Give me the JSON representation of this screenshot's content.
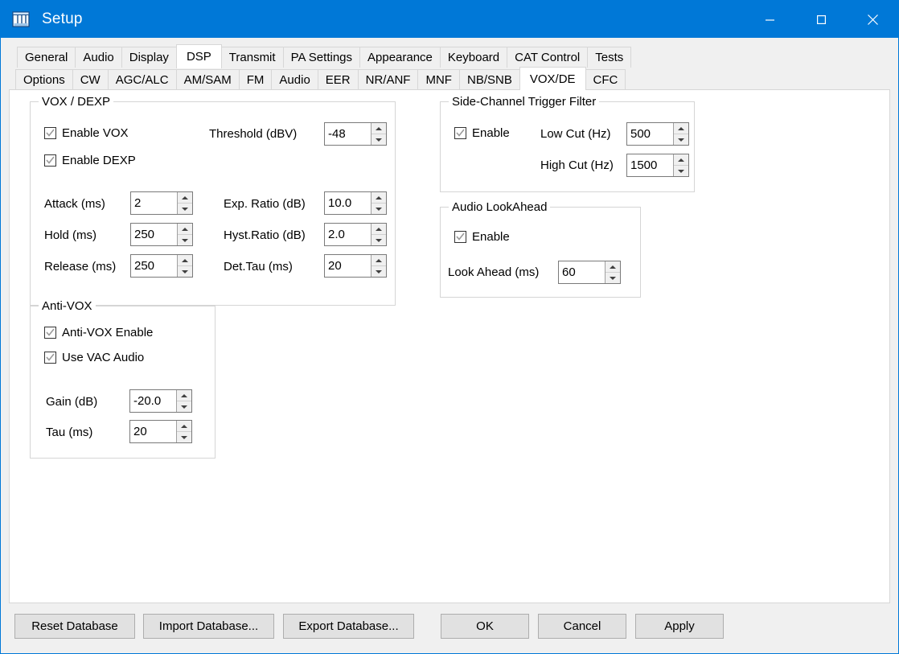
{
  "window": {
    "title": "Setup",
    "icon": "setup-window-icon",
    "titlebar_color": "#0078d7",
    "minimize_label": "Minimize",
    "maximize_label": "Maximize",
    "close_label": "Close"
  },
  "tabs_primary": [
    {
      "label": "General",
      "selected": false
    },
    {
      "label": "Audio",
      "selected": false
    },
    {
      "label": "Display",
      "selected": false
    },
    {
      "label": "DSP",
      "selected": true
    },
    {
      "label": "Transmit",
      "selected": false
    },
    {
      "label": "PA Settings",
      "selected": false
    },
    {
      "label": "Appearance",
      "selected": false
    },
    {
      "label": "Keyboard",
      "selected": false
    },
    {
      "label": "CAT Control",
      "selected": false
    },
    {
      "label": "Tests",
      "selected": false
    }
  ],
  "tabs_secondary": [
    {
      "label": "Options",
      "selected": false
    },
    {
      "label": "CW",
      "selected": false
    },
    {
      "label": "AGC/ALC",
      "selected": false
    },
    {
      "label": "AM/SAM",
      "selected": false
    },
    {
      "label": "FM",
      "selected": false
    },
    {
      "label": "Audio",
      "selected": false
    },
    {
      "label": "EER",
      "selected": false
    },
    {
      "label": "NR/ANF",
      "selected": false
    },
    {
      "label": "MNF",
      "selected": false
    },
    {
      "label": "NB/SNB",
      "selected": false
    },
    {
      "label": "VOX/DE",
      "selected": true
    },
    {
      "label": "CFC",
      "selected": false
    }
  ],
  "vox_dexp": {
    "title": "VOX / DEXP",
    "enable_vox": {
      "label": "Enable VOX",
      "checked": true
    },
    "enable_dexp": {
      "label": "Enable DEXP",
      "checked": true
    },
    "threshold": {
      "label": "Threshold (dBV)",
      "value": "-48"
    },
    "attack": {
      "label": "Attack (ms)",
      "value": "2"
    },
    "hold": {
      "label": "Hold (ms)",
      "value": "250"
    },
    "release": {
      "label": "Release (ms)",
      "value": "250"
    },
    "exp_ratio": {
      "label": "Exp. Ratio (dB)",
      "value": "10.0"
    },
    "hyst_ratio": {
      "label": "Hyst.Ratio (dB)",
      "value": "2.0"
    },
    "det_tau": {
      "label": "Det.Tau (ms)",
      "value": "20"
    }
  },
  "anti_vox": {
    "title": "Anti-VOX",
    "enable": {
      "label": "Anti-VOX Enable",
      "checked": true
    },
    "use_vac_audio": {
      "label": "Use VAC Audio",
      "checked": true
    },
    "gain": {
      "label": "Gain (dB)",
      "value": "-20.0"
    },
    "tau": {
      "label": "Tau (ms)",
      "value": "20"
    }
  },
  "side_channel": {
    "title": "Side-Channel Trigger Filter",
    "enable": {
      "label": "Enable",
      "checked": true
    },
    "low_cut": {
      "label": "Low  Cut (Hz)",
      "value": "500"
    },
    "high_cut": {
      "label": "High Cut (Hz)",
      "value": "1500"
    }
  },
  "look_ahead": {
    "title": "Audio LookAhead",
    "enable": {
      "label": "Enable",
      "checked": true
    },
    "look_ahead": {
      "label": "Look Ahead (ms)",
      "value": "60"
    }
  },
  "buttons": {
    "reset_database": "Reset Database",
    "import_database": "Import Database...",
    "export_database": "Export Database...",
    "ok": "OK",
    "cancel": "Cancel",
    "apply": "Apply"
  }
}
